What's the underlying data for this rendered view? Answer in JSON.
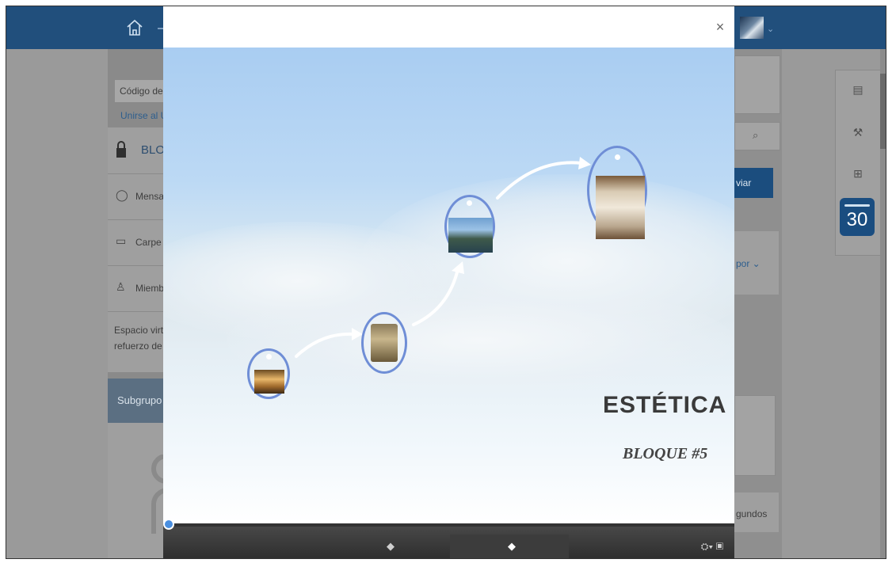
{
  "left": {
    "codigo_placeholder": "Código de",
    "unirse": "Unirse al U",
    "block_title": "BLO",
    "mensajes": "Mensa",
    "carpetas": "Carpe",
    "miembros": "Miemb",
    "desc_line1": "Espacio virt",
    "desc_line2": "refuerzo de",
    "subgrupos": "Subgrupo"
  },
  "right": {
    "enviar": "viar",
    "por": "por ⌄",
    "segundos": "gundos"
  },
  "calendar": {
    "day": "30"
  },
  "modal": {
    "close": "×",
    "title": "ESTÉTICA",
    "subtitle": "BLOQUE #5",
    "prev": "◆",
    "next": "◆",
    "tools": "⛭▾ ▣"
  },
  "colors": {
    "topbar": "#214f7c",
    "node_ring": "#6f8ed6",
    "progress": "#4a8fe0"
  },
  "icons": [
    "home-icon",
    "lock-icon",
    "chat-icon",
    "folder-icon",
    "members-icon",
    "store-icon",
    "wrench-icon",
    "grid-icon",
    "calendar-icon",
    "search-icon",
    "close-icon",
    "prev-arrow-icon",
    "next-arrow-icon",
    "settings-icon",
    "fullscreen-icon"
  ]
}
